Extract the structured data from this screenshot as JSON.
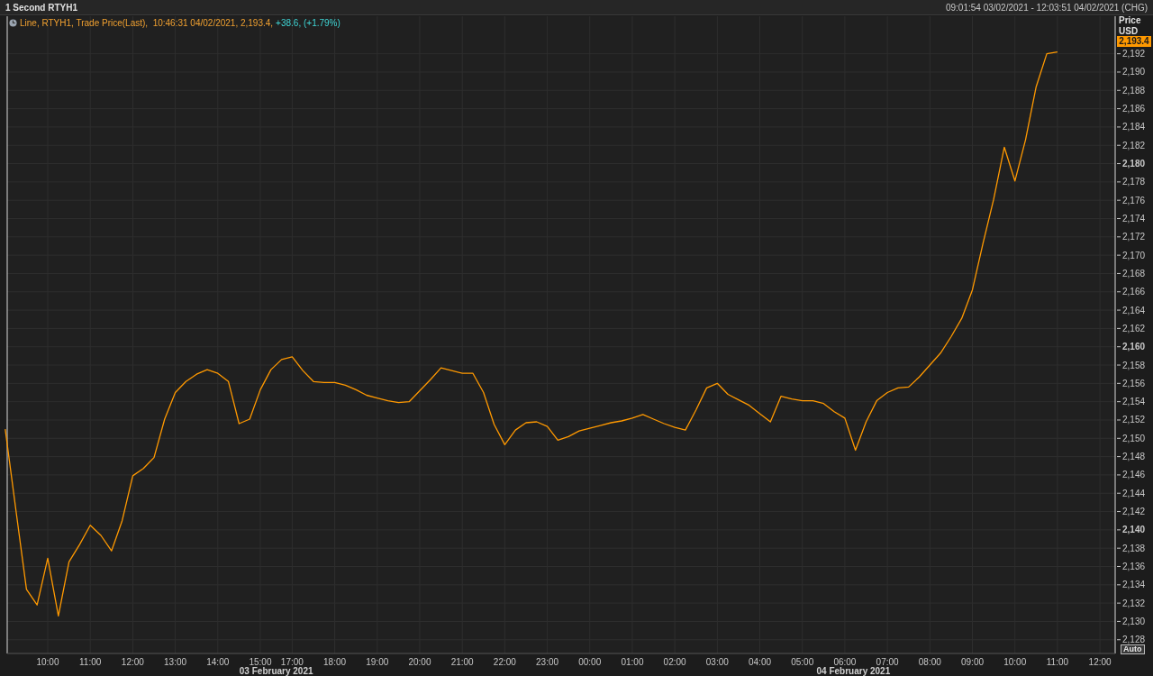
{
  "window": {
    "title": "1 Second RTYH1",
    "range": "09:01:54 03/02/2021 - 12:03:51 04/02/2021 (CHG)"
  },
  "legend": {
    "series_text": "Line, RTYH1, Trade Price(Last),  10:46:31 04/02/2021, 2,193.4,",
    "change_text": "+38.6, (+1.79%)"
  },
  "price_axis": {
    "title": "Price",
    "unit": "USD"
  },
  "last_price": "2,193.4",
  "auto_button": "Auto",
  "chart_data": {
    "type": "line",
    "categories": [
      null,
      null,
      null,
      null,
      "10:00",
      null,
      null,
      null,
      "11:00",
      null,
      null,
      null,
      "12:00",
      null,
      null,
      null,
      "13:00",
      null,
      null,
      null,
      "14:00",
      null,
      null,
      null,
      "15:00",
      null,
      null,
      "17:00",
      null,
      null,
      null,
      "18:00",
      null,
      null,
      null,
      "19:00",
      null,
      null,
      null,
      "20:00",
      null,
      null,
      null,
      "21:00",
      null,
      null,
      null,
      "22:00",
      null,
      null,
      null,
      "23:00",
      null,
      null,
      null,
      "00:00",
      null,
      null,
      null,
      "01:00",
      null,
      null,
      null,
      "02:00",
      null,
      null,
      null,
      "03:00",
      null,
      null,
      null,
      "04:00",
      null,
      null,
      null,
      "05:00",
      null,
      null,
      null,
      "06:00",
      null,
      null,
      null,
      "07:00",
      null,
      null,
      null,
      "08:00",
      null,
      null,
      null,
      "09:00",
      null,
      null,
      null,
      "10:00",
      null,
      null,
      null,
      "11:00",
      null,
      null,
      null,
      "12:00"
    ],
    "series": [
      {
        "color": "#ff9900",
        "values": [
          2151.0,
          2142.2,
          2133.5,
          2131.8,
          2136.9,
          2130.6,
          2136.5,
          2138.4,
          2140.5,
          2139.4,
          2137.7,
          2141.0,
          2145.9,
          2146.7,
          2147.9,
          2152.1,
          2155.0,
          2156.2,
          2157.0,
          2157.5,
          2157.1,
          2156.2,
          2151.6,
          2152.1,
          2155.3,
          2157.5,
          2158.6,
          2158.9,
          2157.4,
          2156.2,
          2156.1,
          2156.1,
          2155.8,
          2155.3,
          2154.7,
          2154.4,
          2154.1,
          2153.9,
          2154.0,
          2155.2,
          2156.4,
          2157.7,
          2157.4,
          2157.1,
          2157.1,
          2155.0,
          2151.5,
          2149.3,
          2150.9,
          2151.7,
          2151.8,
          2151.3,
          2149.8,
          2150.2,
          2150.8,
          2151.1,
          2151.4,
          2151.7,
          2151.9,
          2152.2,
          2152.6,
          2152.1,
          2151.6,
          2151.2,
          2150.9,
          2153.1,
          2155.5,
          2156.0,
          2154.8,
          2154.2,
          2153.6,
          2152.7,
          2151.8,
          2154.6,
          2154.3,
          2154.1,
          2154.1,
          2153.8,
          2152.9,
          2152.2,
          2148.7,
          2151.8,
          2154.1,
          2155.0,
          2155.5,
          2155.6,
          2156.7,
          2158.0,
          2159.3,
          2161.1,
          2163.1,
          2166.2,
          2171.3,
          2176.1,
          2181.8,
          2178.1,
          2182.6,
          2188.4,
          2192.0,
          2192.2,
          null,
          null,
          null,
          null
        ]
      }
    ],
    "ylim": [
      2126.5,
      2196.1
    ],
    "grid": true,
    "yticks": [
      {
        "value": 2128,
        "label": "2,128"
      },
      {
        "value": 2130,
        "label": "2,130"
      },
      {
        "value": 2132,
        "label": "2,132"
      },
      {
        "value": 2134,
        "label": "2,134"
      },
      {
        "value": 2136,
        "label": "2,136"
      },
      {
        "value": 2138,
        "label": "2,138"
      },
      {
        "value": 2140,
        "label": "2,140"
      },
      {
        "value": 2142,
        "label": "2,142"
      },
      {
        "value": 2144,
        "label": "2,144"
      },
      {
        "value": 2146,
        "label": "2,146"
      },
      {
        "value": 2148,
        "label": "2,148"
      },
      {
        "value": 2150,
        "label": "2,150"
      },
      {
        "value": 2152,
        "label": "2,152"
      },
      {
        "value": 2154,
        "label": "2,154"
      },
      {
        "value": 2156,
        "label": "2,156"
      },
      {
        "value": 2158,
        "label": "2,158"
      },
      {
        "value": 2160,
        "label": "2,160"
      },
      {
        "value": 2162,
        "label": "2,162"
      },
      {
        "value": 2164,
        "label": "2,164"
      },
      {
        "value": 2166,
        "label": "2,166"
      },
      {
        "value": 2168,
        "label": "2,168"
      },
      {
        "value": 2170,
        "label": "2,170"
      },
      {
        "value": 2172,
        "label": "2,172"
      },
      {
        "value": 2174,
        "label": "2,174"
      },
      {
        "value": 2176,
        "label": "2,176"
      },
      {
        "value": 2178,
        "label": "2,178"
      },
      {
        "value": 2180,
        "label": "2,180"
      },
      {
        "value": 2182,
        "label": "2,182"
      },
      {
        "value": 2184,
        "label": "2,184"
      },
      {
        "value": 2186,
        "label": "2,186"
      },
      {
        "value": 2188,
        "label": "2,188"
      },
      {
        "value": 2190,
        "label": "2,190"
      },
      {
        "value": 2192,
        "label": "2,192"
      }
    ],
    "annotations": [
      "03 February 2021",
      "04 February 2021"
    ]
  }
}
